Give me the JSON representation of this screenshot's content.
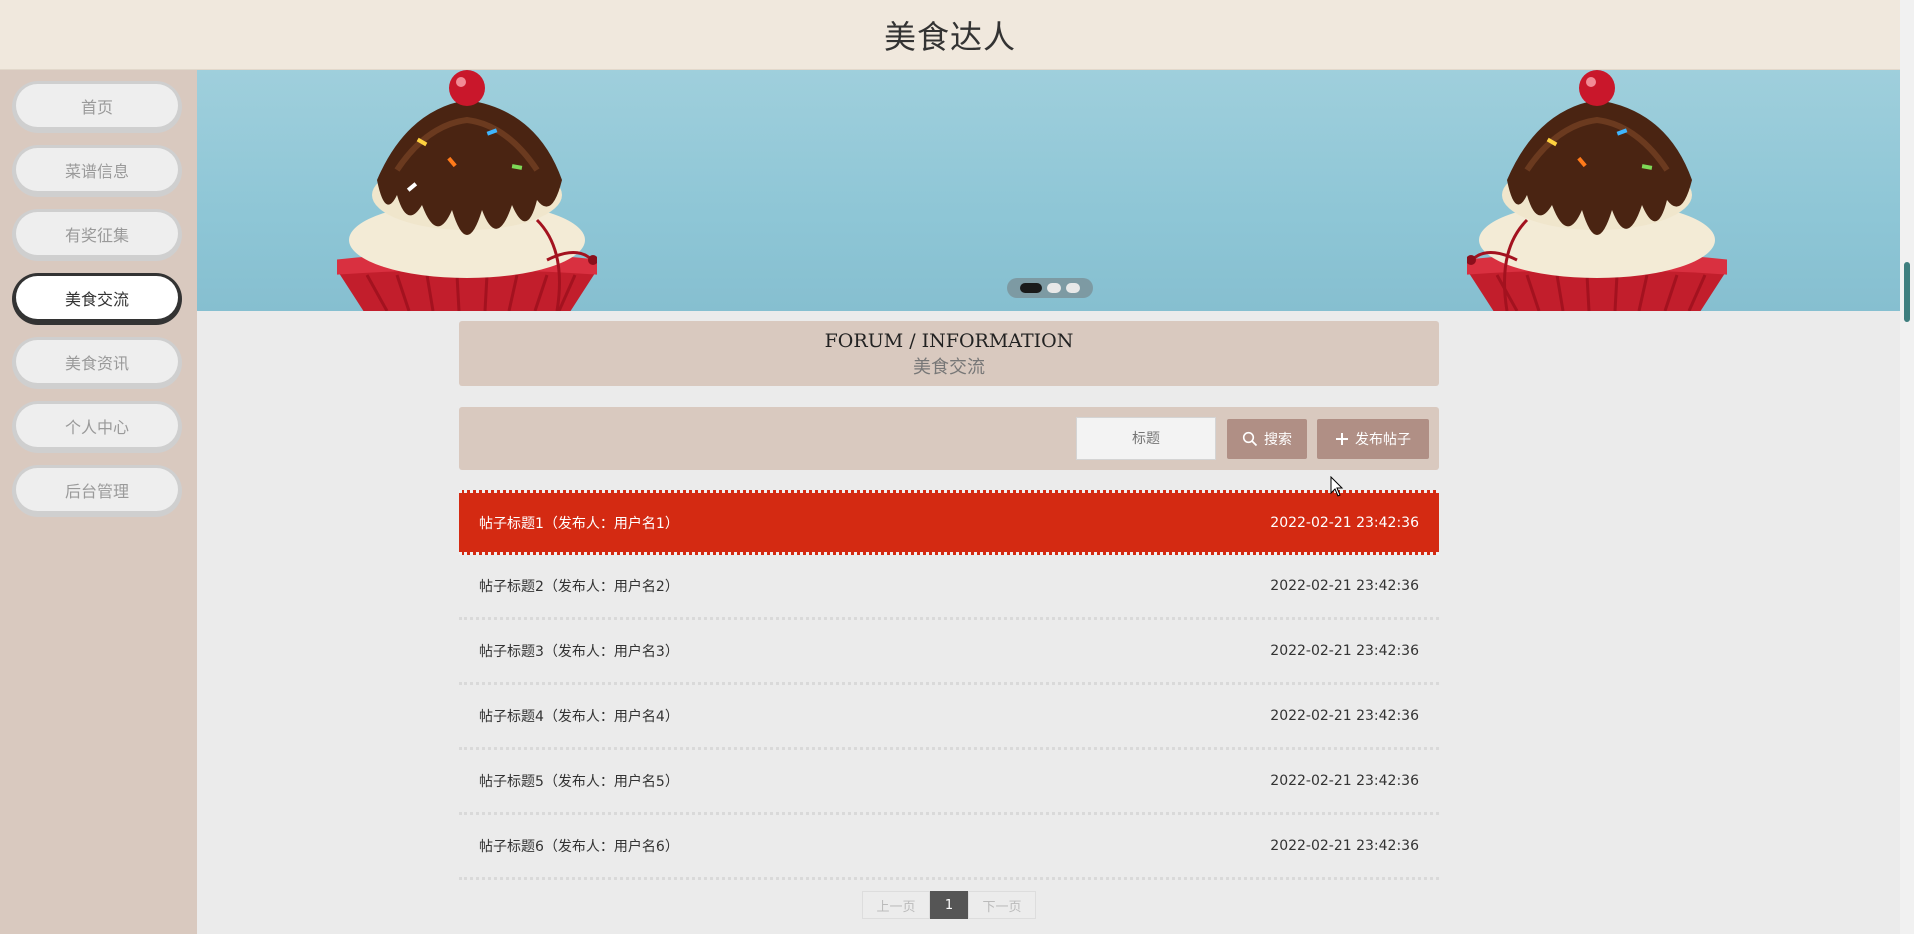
{
  "header": {
    "title": "美食达人"
  },
  "nav": [
    {
      "label": "首页",
      "active": false
    },
    {
      "label": "菜谱信息",
      "active": false
    },
    {
      "label": "有奖征集",
      "active": false
    },
    {
      "label": "美食交流",
      "active": true
    },
    {
      "label": "美食资讯",
      "active": false
    },
    {
      "label": "个人中心",
      "active": false
    },
    {
      "label": "后台管理",
      "active": false
    }
  ],
  "banner": {
    "slide_count": 3,
    "active_slide": 1
  },
  "section": {
    "title_en": "FORUM / INFORMATION",
    "title_cn": "美食交流"
  },
  "toolbar": {
    "search_placeholder": "标题",
    "search_label": "搜索",
    "add_label": "发布帖子",
    "search_icon": "search-icon",
    "add_icon": "plus-icon"
  },
  "posts": [
    {
      "title": "帖子标题1（发布人：用户名1）",
      "time": "2022-02-21 23:42:36"
    },
    {
      "title": "帖子标题2（发布人：用户名2）",
      "time": "2022-02-21 23:42:36"
    },
    {
      "title": "帖子标题3（发布人：用户名3）",
      "time": "2022-02-21 23:42:36"
    },
    {
      "title": "帖子标题4（发布人：用户名4）",
      "time": "2022-02-21 23:42:36"
    },
    {
      "title": "帖子标题5（发布人：用户名5）",
      "time": "2022-02-21 23:42:36"
    },
    {
      "title": "帖子标题6（发布人：用户名6）",
      "time": "2022-02-21 23:42:36"
    }
  ],
  "pagination": {
    "prev": "上一页",
    "current": "1",
    "next": "下一页"
  },
  "colors": {
    "header_bg": "#f0e8dd",
    "sidebar_bg": "#d9c9bf",
    "accent": "#b08f85",
    "highlight_row": "#d42a12"
  }
}
